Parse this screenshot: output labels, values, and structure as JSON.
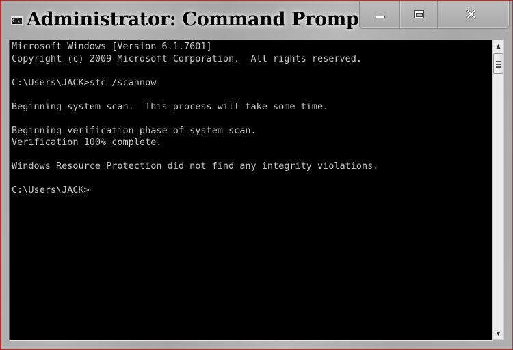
{
  "window": {
    "title": "Administrator: Command Prompt",
    "icon": "cmd-icon",
    "icon_text": "C:\\.",
    "frame_accent": "#e02020",
    "caption_buttons": {
      "minimize": "minimize-icon",
      "maximize": "maximize-icon",
      "close": "close-icon",
      "close_glyph": "✕"
    }
  },
  "console": {
    "background": "#000000",
    "foreground": "#c8c8c8",
    "lines": [
      "Microsoft Windows [Version 6.1.7601]",
      "Copyright (c) 2009 Microsoft Corporation.  All rights reserved.",
      "",
      "C:\\Users\\JACK>sfc /scannow",
      "",
      "Beginning system scan.  This process will take some time.",
      "",
      "Beginning verification phase of system scan.",
      "Verification 100% complete.",
      "",
      "Windows Resource Protection did not find any integrity violations.",
      "",
      "C:\\Users\\JACK>"
    ]
  },
  "scrollbar": {
    "up_arrow": "▲",
    "down_arrow": "▼",
    "position_fraction": 0.0
  }
}
